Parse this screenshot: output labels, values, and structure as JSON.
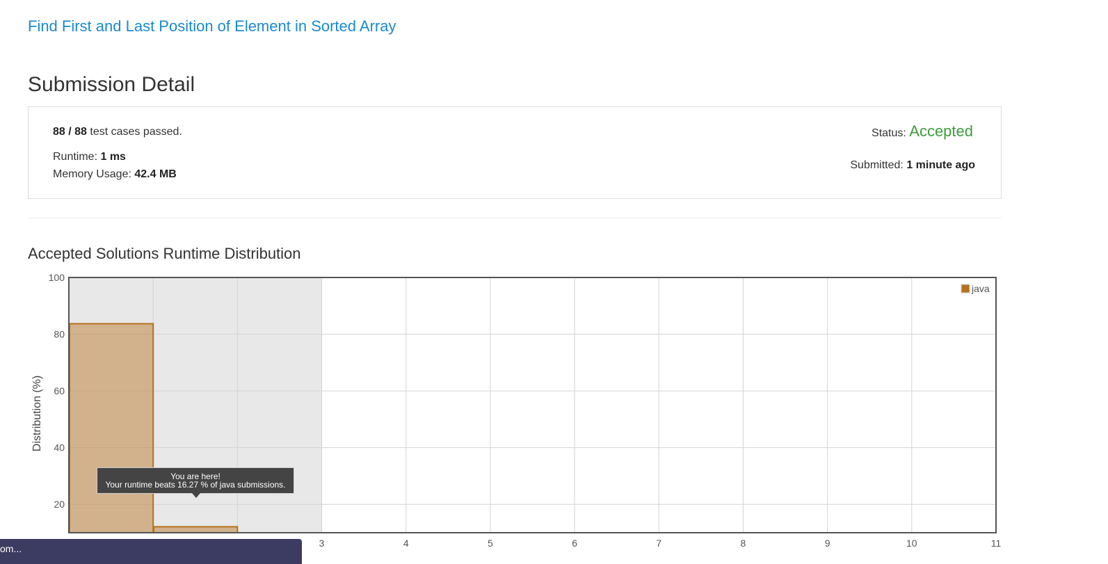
{
  "problem": {
    "title": "Find First and Last Position of Element in Sorted Array"
  },
  "page": {
    "title": "Submission Detail"
  },
  "submission": {
    "passed": "88",
    "separator": " / ",
    "total": "88",
    "cases_suffix": " test cases passed.",
    "runtime_label": "Runtime: ",
    "runtime_value": "1 ms",
    "memory_label": "Memory Usage: ",
    "memory_value": "42.4 MB",
    "status_label": "Status: ",
    "status_value": "Accepted",
    "submitted_label": "Submitted: ",
    "submitted_value": "1 minute ago",
    "status_color": "#3c9c3c"
  },
  "distribution": {
    "title": "Accepted Solutions Runtime Distribution"
  },
  "tooltip": {
    "line1": "You are here!",
    "line2": "Your runtime beats 16.27 % of java submissions."
  },
  "bottom_bar": {
    "text": "om..."
  },
  "chart_data": {
    "type": "bar",
    "ylabel": "Distribution (%)",
    "ylim": [
      10,
      100
    ],
    "yticks": [
      20,
      40,
      60,
      80,
      100
    ],
    "xlim": [
      0,
      11
    ],
    "xticks": [
      3,
      4,
      5,
      6,
      7,
      8,
      9,
      10,
      11
    ],
    "highlight_range": [
      0,
      3
    ],
    "legend": [
      "java"
    ],
    "legend_position": "top-right",
    "grid": true,
    "bar_color": "#b5721c",
    "series": [
      {
        "name": "java",
        "bins": [
          {
            "x0": 0,
            "x1": 1,
            "value": 83.7
          },
          {
            "x0": 1,
            "x1": 2,
            "value": 12.1
          }
        ]
      }
    ]
  }
}
